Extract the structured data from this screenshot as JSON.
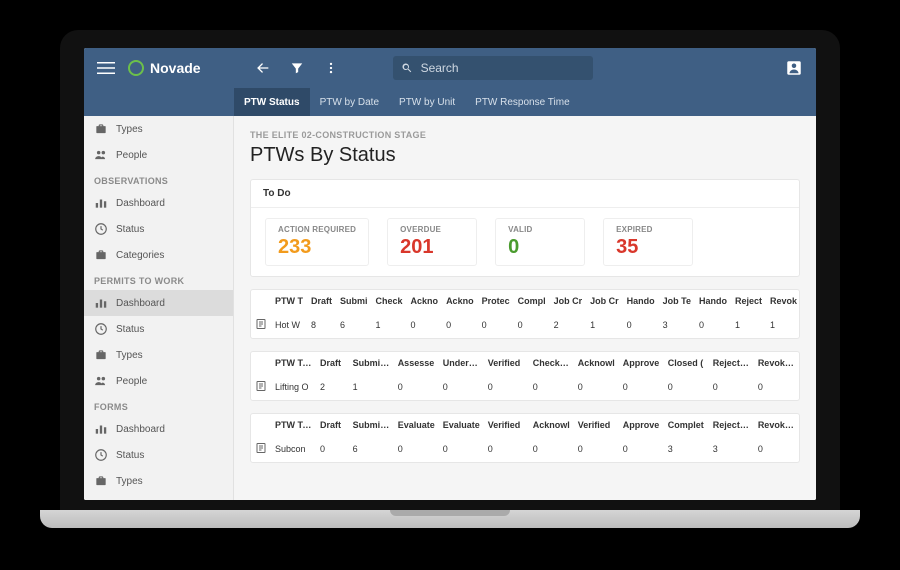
{
  "brand": "Novade",
  "search_placeholder": "Search",
  "tabs": [
    {
      "label": "PTW Status",
      "active": true
    },
    {
      "label": "PTW by Date"
    },
    {
      "label": "PTW by Unit"
    },
    {
      "label": "PTW Response Time"
    }
  ],
  "sidebar": [
    {
      "type": "item",
      "icon": "briefcase",
      "label": "Types"
    },
    {
      "type": "item",
      "icon": "people",
      "label": "People"
    },
    {
      "type": "header",
      "label": "OBSERVATIONS"
    },
    {
      "type": "item",
      "icon": "chart",
      "label": "Dashboard"
    },
    {
      "type": "item",
      "icon": "clock",
      "label": "Status"
    },
    {
      "type": "item",
      "icon": "briefcase",
      "label": "Categories"
    },
    {
      "type": "header",
      "label": "PERMITS TO WORK"
    },
    {
      "type": "item",
      "icon": "chart",
      "label": "Dashboard",
      "active": true
    },
    {
      "type": "item",
      "icon": "clock",
      "label": "Status"
    },
    {
      "type": "item",
      "icon": "briefcase",
      "label": "Types"
    },
    {
      "type": "item",
      "icon": "people",
      "label": "People"
    },
    {
      "type": "header",
      "label": "FORMS"
    },
    {
      "type": "item",
      "icon": "chart",
      "label": "Dashboard"
    },
    {
      "type": "item",
      "icon": "clock",
      "label": "Status"
    },
    {
      "type": "item",
      "icon": "briefcase",
      "label": "Types"
    }
  ],
  "breadcrumb": "THE ELITE 02-CONSTRUCTION STAGE",
  "title": "PTWs By Status",
  "todo_header": "To Do",
  "summary": [
    {
      "label": "ACTION REQUIRED",
      "value": "233",
      "cls": "c-orange"
    },
    {
      "label": "OVERDUE",
      "value": "201",
      "cls": "c-red"
    },
    {
      "label": "VALID",
      "value": "0",
      "cls": "c-green"
    },
    {
      "label": "EXPIRED",
      "value": "35",
      "cls": "c-red"
    }
  ],
  "tables": [
    {
      "headers": [
        {
          "t": "PTW T",
          "c": "st-grey"
        },
        {
          "t": "Draft",
          "c": "st-orange"
        },
        {
          "t": "Submi",
          "c": "st-orange"
        },
        {
          "t": "Check",
          "c": "st-green"
        },
        {
          "t": "Ackno",
          "c": "st-green"
        },
        {
          "t": "Ackno",
          "c": "st-green"
        },
        {
          "t": "Protec",
          "c": "st-green"
        },
        {
          "t": "Compl",
          "c": "st-green"
        },
        {
          "t": "Job Cr",
          "c": "st-grey"
        },
        {
          "t": "Job Cr",
          "c": "st-grey"
        },
        {
          "t": "Hando",
          "c": "st-grey"
        },
        {
          "t": "Job Te",
          "c": "st-grey"
        },
        {
          "t": "Hando",
          "c": "st-grey"
        },
        {
          "t": "Reject",
          "c": "st-red"
        },
        {
          "t": "Revok",
          "c": "st-red"
        }
      ],
      "row_label": "Hot W",
      "values": [
        "8",
        "6",
        "1",
        "0",
        "0",
        "0",
        "0",
        "2",
        "1",
        "0",
        "3",
        "0",
        "1",
        "1"
      ]
    },
    {
      "headers": [
        {
          "t": "PTW Typ",
          "c": "st-grey"
        },
        {
          "t": "Draft",
          "c": "st-orange"
        },
        {
          "t": "Submitte",
          "c": "st-orange"
        },
        {
          "t": "Assesse",
          "c": "st-green"
        },
        {
          "t": "Undertak",
          "c": "st-green"
        },
        {
          "t": "Verified",
          "c": "st-green"
        },
        {
          "t": "Checked",
          "c": "st-green"
        },
        {
          "t": "Acknowl",
          "c": "st-grey"
        },
        {
          "t": "Approve",
          "c": "st-orange"
        },
        {
          "t": "Closed (",
          "c": "st-grey"
        },
        {
          "t": "Rejected",
          "c": "st-red"
        },
        {
          "t": "Revoked",
          "c": "st-red"
        }
      ],
      "row_label": "Lifting O",
      "values": [
        "2",
        "1",
        "0",
        "0",
        "0",
        "0",
        "0",
        "0",
        "0",
        "0",
        "0"
      ]
    },
    {
      "headers": [
        {
          "t": "PTW Typ",
          "c": "st-grey"
        },
        {
          "t": "Draft",
          "c": "st-orange"
        },
        {
          "t": "Submitte",
          "c": "st-orange"
        },
        {
          "t": "Evaluate",
          "c": "st-green"
        },
        {
          "t": "Evaluate",
          "c": "st-green"
        },
        {
          "t": "Verified",
          "c": "st-green"
        },
        {
          "t": "Acknowl",
          "c": "st-green"
        },
        {
          "t": "Verified",
          "c": "st-grey"
        },
        {
          "t": "Approve",
          "c": "st-orange"
        },
        {
          "t": "Complet",
          "c": "st-grey"
        },
        {
          "t": "Rejected",
          "c": "st-red"
        },
        {
          "t": "Revoked",
          "c": "st-red"
        }
      ],
      "row_label": "Subcon",
      "values": [
        "0",
        "6",
        "0",
        "0",
        "0",
        "0",
        "0",
        "0",
        "3",
        "3",
        "0"
      ]
    }
  ]
}
